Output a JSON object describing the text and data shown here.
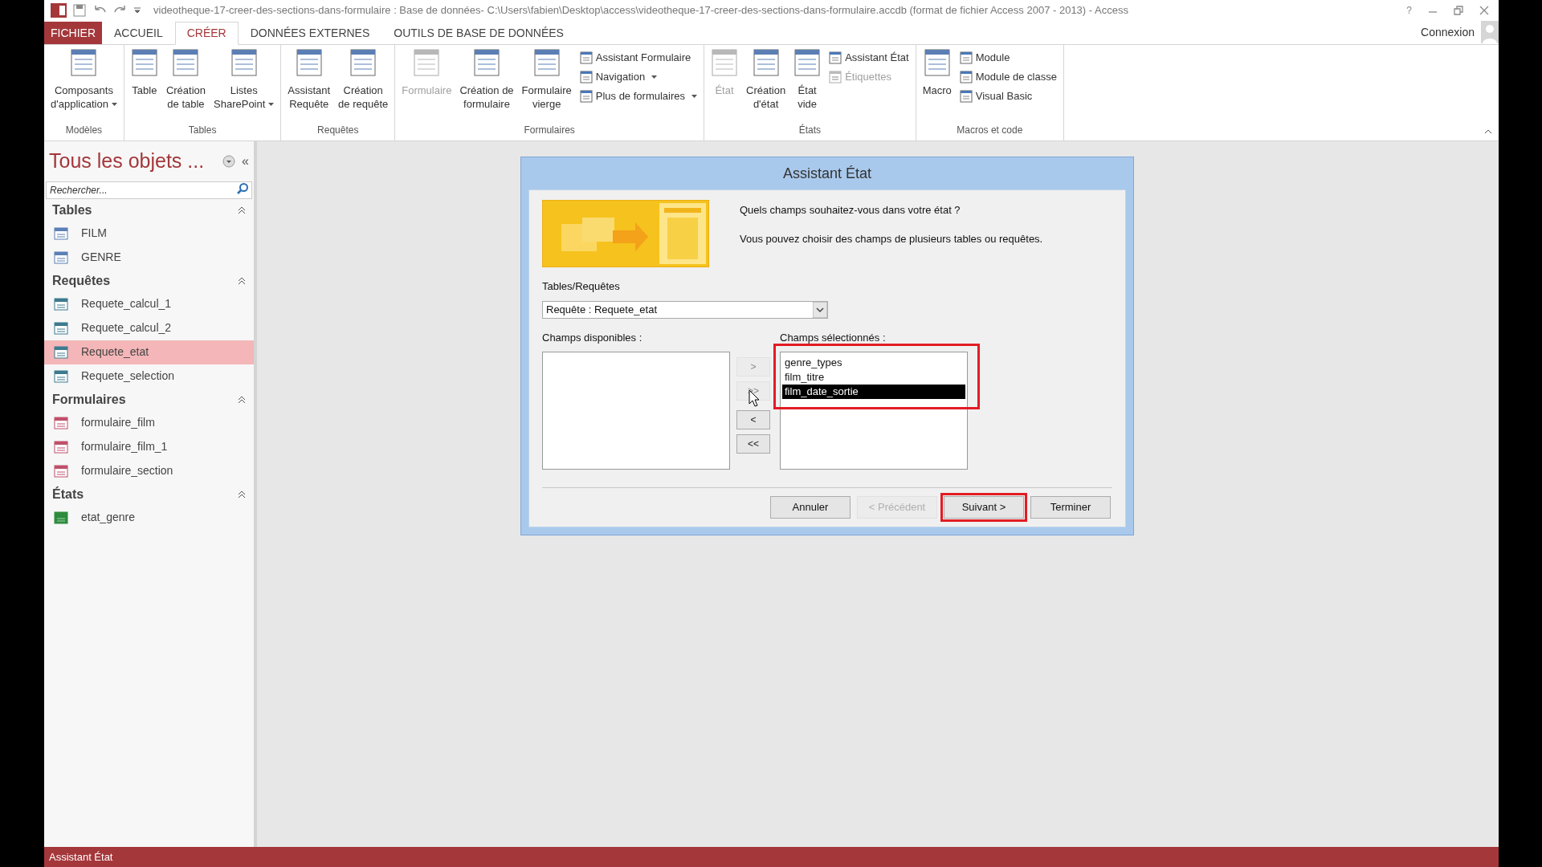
{
  "window": {
    "title": "videotheque-17-creer-des-sections-dans-formulaire : Base de données- C:\\Users\\fabien\\Desktop\\access\\videotheque-17-creer-des-sections-dans-formulaire.accdb (format de fichier Access 2007 - 2013) - Access",
    "controls": [
      "?"
    ]
  },
  "tabs": [
    {
      "label": "FICHIER",
      "kind": "file",
      "selected": false
    },
    {
      "label": "ACCUEIL",
      "kind": "tab",
      "selected": false
    },
    {
      "label": "CRÉER",
      "kind": "tab",
      "selected": true
    },
    {
      "label": "DONNÉES EXTERNES",
      "kind": "tab",
      "selected": false
    },
    {
      "label": "OUTILS DE BASE DE DONNÉES",
      "kind": "tab",
      "selected": false
    }
  ],
  "account": {
    "label": "Connexion"
  },
  "ribbon": {
    "groups": [
      {
        "label": "Modèles",
        "items": [
          {
            "kind": "large",
            "lines": [
              "Composants",
              "d'application"
            ],
            "dropdown": true,
            "disabled": false
          }
        ]
      },
      {
        "label": "Tables",
        "items": [
          {
            "kind": "large",
            "lines": [
              "Table"
            ],
            "dropdown": false,
            "disabled": false
          },
          {
            "kind": "large",
            "lines": [
              "Création",
              "de table"
            ],
            "dropdown": false,
            "disabled": false
          },
          {
            "kind": "large",
            "lines": [
              "Listes",
              "SharePoint"
            ],
            "dropdown": true,
            "disabled": false
          }
        ]
      },
      {
        "label": "Requêtes",
        "items": [
          {
            "kind": "large",
            "lines": [
              "Assistant",
              "Requête"
            ],
            "dropdown": false,
            "disabled": false
          },
          {
            "kind": "large",
            "lines": [
              "Création",
              "de requête"
            ],
            "dropdown": false,
            "disabled": false
          }
        ]
      },
      {
        "label": "Formulaires",
        "items": [
          {
            "kind": "large",
            "lines": [
              "Formulaire"
            ],
            "dropdown": false,
            "disabled": true
          },
          {
            "kind": "large",
            "lines": [
              "Création de",
              "formulaire"
            ],
            "dropdown": false,
            "disabled": false
          },
          {
            "kind": "large",
            "lines": [
              "Formulaire",
              "vierge"
            ],
            "dropdown": false,
            "disabled": false
          },
          {
            "kind": "small",
            "lines": [
              "Assistant Formulaire"
            ],
            "dropdown": false,
            "disabled": false
          },
          {
            "kind": "small",
            "lines": [
              "Navigation"
            ],
            "dropdown": true,
            "disabled": false
          },
          {
            "kind": "small",
            "lines": [
              "Plus de formulaires"
            ],
            "dropdown": true,
            "disabled": false
          }
        ]
      },
      {
        "label": "États",
        "items": [
          {
            "kind": "large",
            "lines": [
              "État"
            ],
            "dropdown": false,
            "disabled": true
          },
          {
            "kind": "large",
            "lines": [
              "Création",
              "d'état"
            ],
            "dropdown": false,
            "disabled": false
          },
          {
            "kind": "large",
            "lines": [
              "État",
              "vide"
            ],
            "dropdown": false,
            "disabled": false
          },
          {
            "kind": "small",
            "lines": [
              "Assistant État"
            ],
            "dropdown": false,
            "disabled": false
          },
          {
            "kind": "small",
            "lines": [
              "Étiquettes"
            ],
            "dropdown": false,
            "disabled": true
          }
        ]
      },
      {
        "label": "Macros et code",
        "items": [
          {
            "kind": "large",
            "lines": [
              "Macro"
            ],
            "dropdown": false,
            "disabled": false
          },
          {
            "kind": "small",
            "lines": [
              "Module"
            ],
            "dropdown": false,
            "disabled": false
          },
          {
            "kind": "small",
            "lines": [
              "Module de classe"
            ],
            "dropdown": false,
            "disabled": false
          },
          {
            "kind": "small",
            "lines": [
              "Visual Basic"
            ],
            "dropdown": false,
            "disabled": false
          }
        ]
      }
    ]
  },
  "sidebar": {
    "title": "Tous les objets ...",
    "collapse": "«",
    "search": {
      "placeholder": "Rechercher..."
    },
    "sections": [
      {
        "title": "Tables",
        "kind": "table",
        "expanded": true,
        "items": [
          {
            "label": "FILM",
            "selected": false
          },
          {
            "label": "GENRE",
            "selected": false
          }
        ]
      },
      {
        "title": "Requêtes",
        "kind": "query",
        "expanded": true,
        "items": [
          {
            "label": "Requete_calcul_1",
            "selected": false
          },
          {
            "label": "Requete_calcul_2",
            "selected": false
          },
          {
            "label": "Requete_etat",
            "selected": true
          },
          {
            "label": "Requete_selection",
            "selected": false
          }
        ]
      },
      {
        "title": "Formulaires",
        "kind": "form",
        "expanded": true,
        "items": [
          {
            "label": "formulaire_film",
            "selected": false
          },
          {
            "label": "formulaire_film_1",
            "selected": false
          },
          {
            "label": "formulaire_section",
            "selected": false
          }
        ]
      },
      {
        "title": "États",
        "kind": "report",
        "expanded": true,
        "items": [
          {
            "label": "etat_genre",
            "selected": false
          }
        ]
      }
    ]
  },
  "dialog": {
    "title": "Assistant État",
    "question": "Quels champs souhaitez-vous dans votre état ?",
    "hint": "Vous pouvez choisir des champs de plusieurs tables ou requêtes.",
    "source_label": "Tables/Requêtes",
    "source_value": "Requête : Requete_etat",
    "available_label": "Champs disponibles :",
    "selected_label": "Champs sélectionnés :",
    "selected_list": {
      "highlighted": true,
      "fields": [
        {
          "label": "genre_types",
          "selected": false
        },
        {
          "label": "film_titre",
          "selected": false
        },
        {
          "label": "film_date_sortie",
          "selected": true
        }
      ]
    },
    "move_buttons": [
      {
        "label": ">",
        "disabled": true
      },
      {
        "label": ">>",
        "disabled": true
      },
      {
        "label": "<",
        "disabled": false
      },
      {
        "label": "<<",
        "disabled": false
      }
    ],
    "buttons": [
      {
        "label": "Annuler",
        "disabled": false,
        "highlighted": false
      },
      {
        "label": "< Précédent",
        "disabled": true,
        "highlighted": false
      },
      {
        "label": "Suivant >",
        "disabled": false,
        "highlighted": true
      },
      {
        "label": "Terminer",
        "disabled": false,
        "highlighted": false
      }
    ]
  },
  "status_bar": {
    "text": "Assistant État"
  }
}
